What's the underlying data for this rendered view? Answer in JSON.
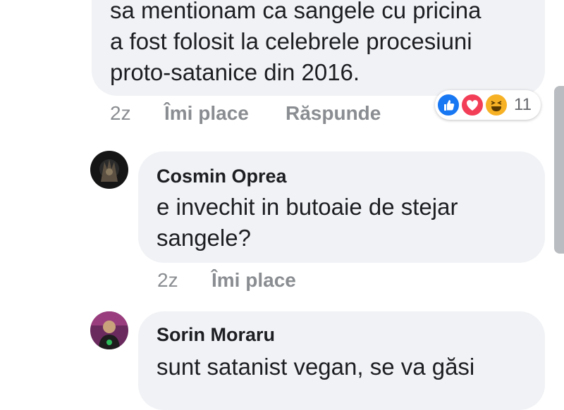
{
  "comments": [
    {
      "lines": [
        "sa mentionam ca sangele cu pricina",
        "a fost folosit la celebrele procesiuni",
        "proto-satanice din 2016."
      ],
      "time": "2z",
      "like_label": "Îmi place",
      "reply_label": "Răspunde",
      "reactions": {
        "count": "11",
        "types": [
          "like-icon",
          "love-icon",
          "haha-icon"
        ]
      }
    },
    {
      "author": "Cosmin Oprea",
      "lines": [
        "e invechit in butoaie de stejar",
        "sangele?"
      ],
      "time": "2z",
      "like_label": "Îmi place"
    },
    {
      "author": "Sorin Moraru",
      "lines": [
        "sunt satanist vegan, se va găsi"
      ]
    }
  ],
  "colors": {
    "bubble": "#f0f2f5",
    "meta_text": "#8a8d91",
    "like_blue": "#1877f2",
    "love_red": "#f33e58",
    "haha_yellow": "#f7b125"
  }
}
